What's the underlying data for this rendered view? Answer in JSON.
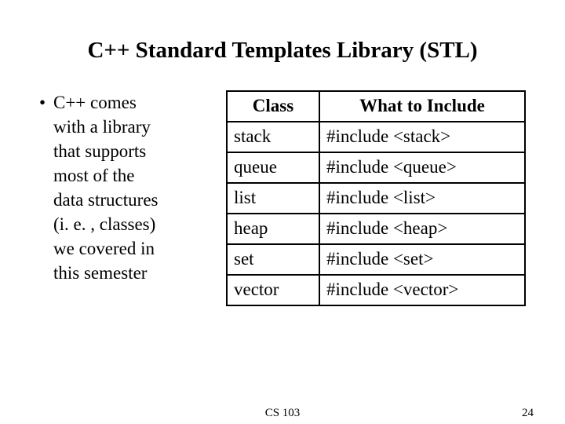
{
  "title": "C++ Standard Templates Library (STL)",
  "bullet": {
    "first": "C++ comes",
    "l1": "with a library",
    "l2": "that supports",
    "l3": "most of the",
    "l4": "data structures",
    "l5": "(i. e. , classes)",
    "l6": "we covered in",
    "l7": "this semester"
  },
  "table": {
    "headers": {
      "class": "Class",
      "include": "What to Include"
    },
    "rows": [
      {
        "class": "stack",
        "include": "#include <stack>"
      },
      {
        "class": "queue",
        "include": "#include <queue>"
      },
      {
        "class": "list",
        "include": "#include <list>"
      },
      {
        "class": "heap",
        "include": "#include <heap>"
      },
      {
        "class": "set",
        "include": "#include <set>"
      },
      {
        "class": "vector",
        "include": "#include <vector>"
      }
    ]
  },
  "footer": {
    "course": "CS 103",
    "page": "24"
  }
}
